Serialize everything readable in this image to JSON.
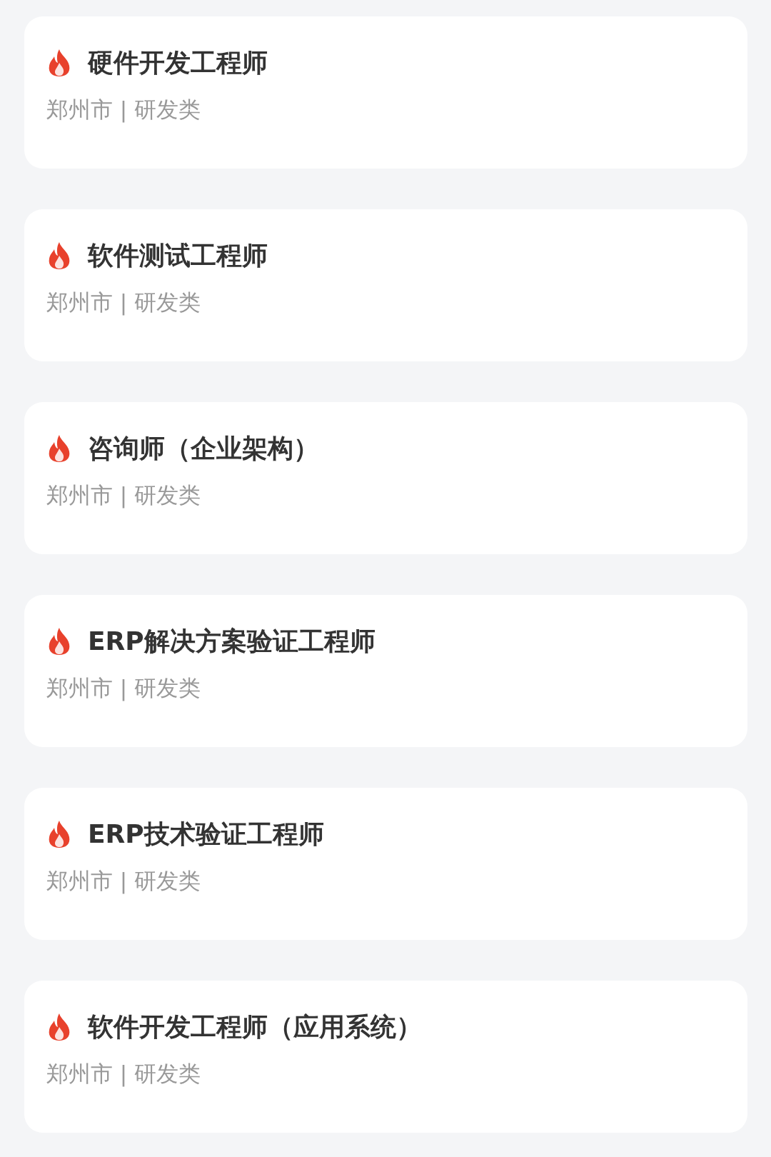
{
  "jobs": [
    {
      "title": "硬件开发工程师",
      "hot": true,
      "meta": "郑州市 | 研发类"
    },
    {
      "title": "软件测试工程师",
      "hot": true,
      "meta": "郑州市 | 研发类"
    },
    {
      "title": "咨询师（企业架构）",
      "hot": true,
      "meta": "郑州市 | 研发类"
    },
    {
      "title": "ERP解决方案验证工程师",
      "hot": true,
      "meta": "郑州市 | 研发类"
    },
    {
      "title": "ERP技术验证工程师",
      "hot": true,
      "meta": "郑州市 | 研发类"
    },
    {
      "title": "软件开发工程师（应用系统）",
      "hot": true,
      "meta": "郑州市 | 研发类"
    }
  ]
}
